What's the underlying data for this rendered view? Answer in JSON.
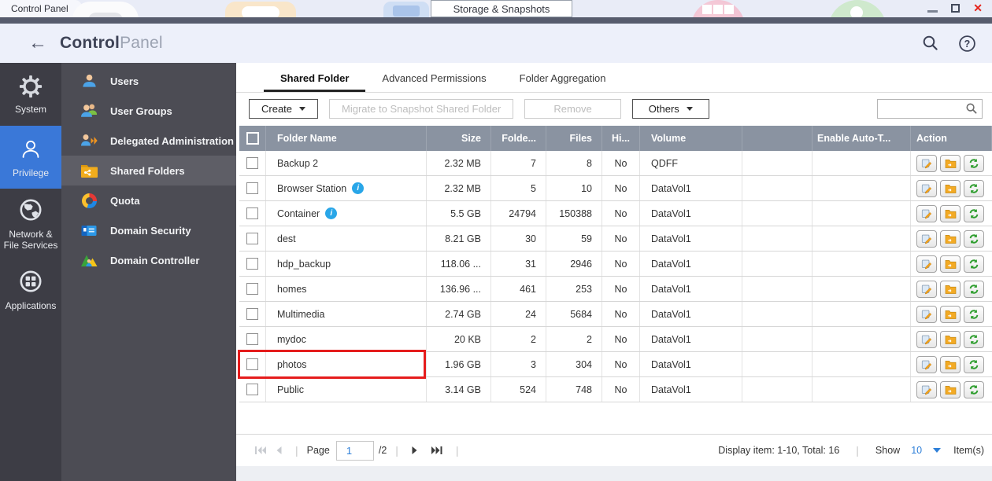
{
  "window": {
    "taskbar_label": "Control Panel",
    "floating_tab": "Storage & Snapshots",
    "controls": {
      "close": "✕"
    }
  },
  "header": {
    "back_glyph": "←",
    "title_bold": "Control",
    "title_light": "Panel"
  },
  "primary_nav": {
    "items": [
      {
        "label": "System",
        "selected": false
      },
      {
        "label": "Privilege",
        "selected": true
      },
      {
        "label_line1": "Network &",
        "label_line2": "File Services",
        "selected": false
      },
      {
        "label": "Applications",
        "selected": false
      }
    ]
  },
  "secondary_nav": {
    "items": [
      {
        "label": "Users",
        "selected": false
      },
      {
        "label": "User Groups",
        "selected": false
      },
      {
        "label": "Delegated Administration",
        "selected": false
      },
      {
        "label": "Shared Folders",
        "selected": true
      },
      {
        "label": "Quota",
        "selected": false
      },
      {
        "label": "Domain Security",
        "selected": false
      },
      {
        "label": "Domain Controller",
        "selected": false
      }
    ]
  },
  "tabs": [
    {
      "label": "Shared Folder",
      "active": true
    },
    {
      "label": "Advanced Permissions",
      "active": false
    },
    {
      "label": "Folder Aggregation",
      "active": false
    }
  ],
  "toolbar": {
    "create_label": "Create",
    "migrate_label": "Migrate to Snapshot Shared Folder",
    "remove_label": "Remove",
    "others_label": "Others",
    "search_placeholder": ""
  },
  "table": {
    "columns": [
      "",
      "Folder Name",
      "Size",
      "Folde...",
      "Files",
      "Hi...",
      "Volume",
      "",
      "Enable Auto-T...",
      "Action"
    ],
    "rows": [
      {
        "name": "Backup 2",
        "info": false,
        "size": "2.32 MB",
        "folders": "7",
        "files": "8",
        "hidden": "No",
        "volume": "QDFF",
        "auto": "",
        "highlighted": false
      },
      {
        "name": "Browser Station",
        "info": true,
        "size": "2.32 MB",
        "folders": "5",
        "files": "10",
        "hidden": "No",
        "volume": "DataVol1",
        "auto": "",
        "highlighted": false
      },
      {
        "name": "Container",
        "info": true,
        "size": "5.5 GB",
        "folders": "24794",
        "files": "150388",
        "hidden": "No",
        "volume": "DataVol1",
        "auto": "",
        "highlighted": false
      },
      {
        "name": "dest",
        "info": false,
        "size": "8.21 GB",
        "folders": "30",
        "files": "59",
        "hidden": "No",
        "volume": "DataVol1",
        "auto": "",
        "highlighted": false
      },
      {
        "name": "hdp_backup",
        "info": false,
        "size": "118.06 ...",
        "folders": "31",
        "files": "2946",
        "hidden": "No",
        "volume": "DataVol1",
        "auto": "",
        "highlighted": false
      },
      {
        "name": "homes",
        "info": false,
        "size": "136.96 ...",
        "folders": "461",
        "files": "253",
        "hidden": "No",
        "volume": "DataVol1",
        "auto": "",
        "highlighted": false
      },
      {
        "name": "Multimedia",
        "info": false,
        "size": "2.74 GB",
        "folders": "24",
        "files": "5684",
        "hidden": "No",
        "volume": "DataVol1",
        "auto": "",
        "highlighted": false
      },
      {
        "name": "mydoc",
        "info": false,
        "size": "20 KB",
        "folders": "2",
        "files": "2",
        "hidden": "No",
        "volume": "DataVol1",
        "auto": "",
        "highlighted": false
      },
      {
        "name": "photos",
        "info": false,
        "size": "1.96 GB",
        "folders": "3",
        "files": "304",
        "hidden": "No",
        "volume": "DataVol1",
        "auto": "",
        "highlighted": true
      },
      {
        "name": "Public",
        "info": false,
        "size": "3.14 GB",
        "folders": "524",
        "files": "748",
        "hidden": "No",
        "volume": "DataVol1",
        "auto": "",
        "highlighted": false
      }
    ]
  },
  "pagination": {
    "page_label": "Page",
    "page_value": "1",
    "page_total": "/2",
    "display_text": "Display item: 1-10, Total: 16",
    "show_label": "Show",
    "show_value": "10",
    "items_label": "Item(s)"
  },
  "colors": {
    "accent_blue": "#3a78d8",
    "table_header_gray": "#8a93a1",
    "highlight_red": "#e51c1c",
    "info_blue": "#29a6e8"
  }
}
